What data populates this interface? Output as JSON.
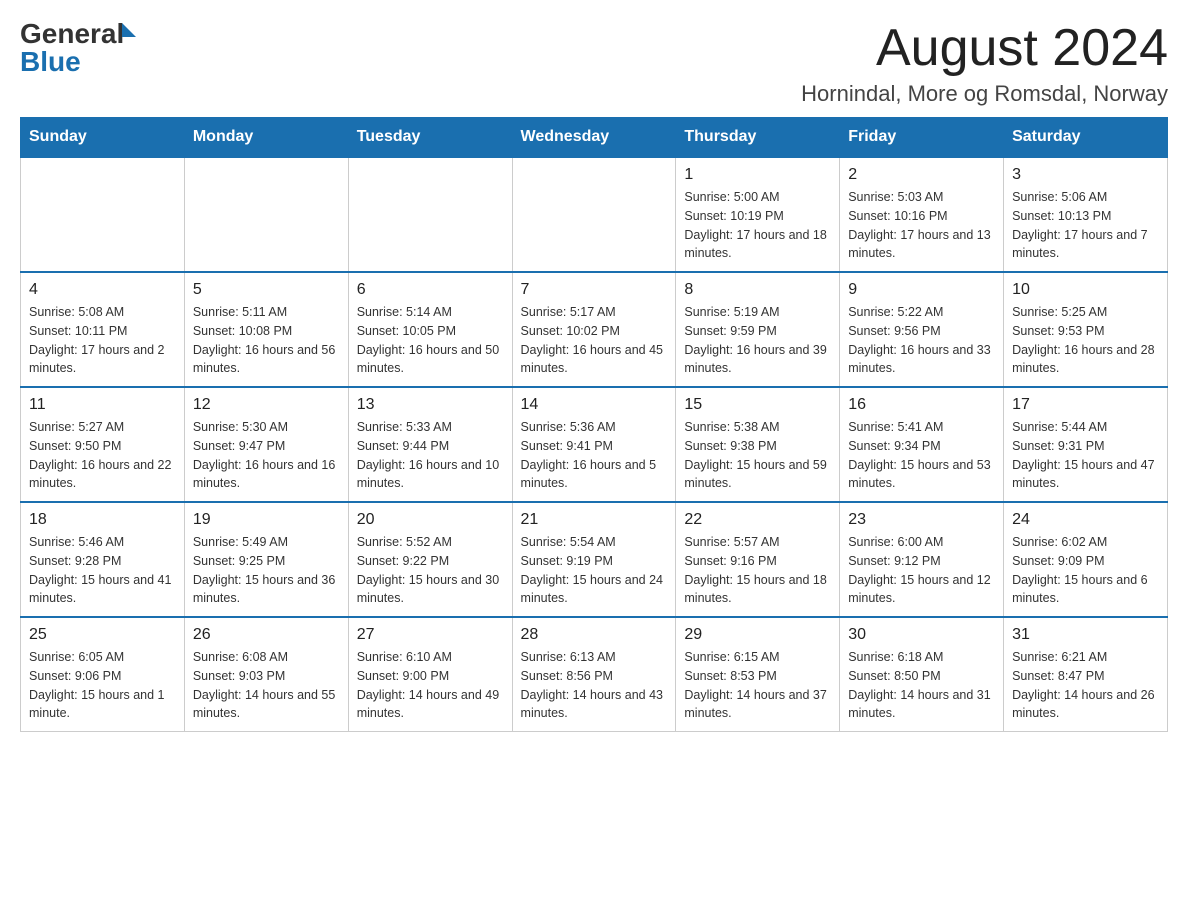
{
  "logo": {
    "general": "General",
    "blue": "Blue"
  },
  "title": {
    "month_year": "August 2024",
    "location": "Hornindal, More og Romsdal, Norway"
  },
  "days_of_week": [
    "Sunday",
    "Monday",
    "Tuesday",
    "Wednesday",
    "Thursday",
    "Friday",
    "Saturday"
  ],
  "weeks": [
    [
      {
        "day": "",
        "info": ""
      },
      {
        "day": "",
        "info": ""
      },
      {
        "day": "",
        "info": ""
      },
      {
        "day": "",
        "info": ""
      },
      {
        "day": "1",
        "info": "Sunrise: 5:00 AM\nSunset: 10:19 PM\nDaylight: 17 hours and 18 minutes."
      },
      {
        "day": "2",
        "info": "Sunrise: 5:03 AM\nSunset: 10:16 PM\nDaylight: 17 hours and 13 minutes."
      },
      {
        "day": "3",
        "info": "Sunrise: 5:06 AM\nSunset: 10:13 PM\nDaylight: 17 hours and 7 minutes."
      }
    ],
    [
      {
        "day": "4",
        "info": "Sunrise: 5:08 AM\nSunset: 10:11 PM\nDaylight: 17 hours and 2 minutes."
      },
      {
        "day": "5",
        "info": "Sunrise: 5:11 AM\nSunset: 10:08 PM\nDaylight: 16 hours and 56 minutes."
      },
      {
        "day": "6",
        "info": "Sunrise: 5:14 AM\nSunset: 10:05 PM\nDaylight: 16 hours and 50 minutes."
      },
      {
        "day": "7",
        "info": "Sunrise: 5:17 AM\nSunset: 10:02 PM\nDaylight: 16 hours and 45 minutes."
      },
      {
        "day": "8",
        "info": "Sunrise: 5:19 AM\nSunset: 9:59 PM\nDaylight: 16 hours and 39 minutes."
      },
      {
        "day": "9",
        "info": "Sunrise: 5:22 AM\nSunset: 9:56 PM\nDaylight: 16 hours and 33 minutes."
      },
      {
        "day": "10",
        "info": "Sunrise: 5:25 AM\nSunset: 9:53 PM\nDaylight: 16 hours and 28 minutes."
      }
    ],
    [
      {
        "day": "11",
        "info": "Sunrise: 5:27 AM\nSunset: 9:50 PM\nDaylight: 16 hours and 22 minutes."
      },
      {
        "day": "12",
        "info": "Sunrise: 5:30 AM\nSunset: 9:47 PM\nDaylight: 16 hours and 16 minutes."
      },
      {
        "day": "13",
        "info": "Sunrise: 5:33 AM\nSunset: 9:44 PM\nDaylight: 16 hours and 10 minutes."
      },
      {
        "day": "14",
        "info": "Sunrise: 5:36 AM\nSunset: 9:41 PM\nDaylight: 16 hours and 5 minutes."
      },
      {
        "day": "15",
        "info": "Sunrise: 5:38 AM\nSunset: 9:38 PM\nDaylight: 15 hours and 59 minutes."
      },
      {
        "day": "16",
        "info": "Sunrise: 5:41 AM\nSunset: 9:34 PM\nDaylight: 15 hours and 53 minutes."
      },
      {
        "day": "17",
        "info": "Sunrise: 5:44 AM\nSunset: 9:31 PM\nDaylight: 15 hours and 47 minutes."
      }
    ],
    [
      {
        "day": "18",
        "info": "Sunrise: 5:46 AM\nSunset: 9:28 PM\nDaylight: 15 hours and 41 minutes."
      },
      {
        "day": "19",
        "info": "Sunrise: 5:49 AM\nSunset: 9:25 PM\nDaylight: 15 hours and 36 minutes."
      },
      {
        "day": "20",
        "info": "Sunrise: 5:52 AM\nSunset: 9:22 PM\nDaylight: 15 hours and 30 minutes."
      },
      {
        "day": "21",
        "info": "Sunrise: 5:54 AM\nSunset: 9:19 PM\nDaylight: 15 hours and 24 minutes."
      },
      {
        "day": "22",
        "info": "Sunrise: 5:57 AM\nSunset: 9:16 PM\nDaylight: 15 hours and 18 minutes."
      },
      {
        "day": "23",
        "info": "Sunrise: 6:00 AM\nSunset: 9:12 PM\nDaylight: 15 hours and 12 minutes."
      },
      {
        "day": "24",
        "info": "Sunrise: 6:02 AM\nSunset: 9:09 PM\nDaylight: 15 hours and 6 minutes."
      }
    ],
    [
      {
        "day": "25",
        "info": "Sunrise: 6:05 AM\nSunset: 9:06 PM\nDaylight: 15 hours and 1 minute."
      },
      {
        "day": "26",
        "info": "Sunrise: 6:08 AM\nSunset: 9:03 PM\nDaylight: 14 hours and 55 minutes."
      },
      {
        "day": "27",
        "info": "Sunrise: 6:10 AM\nSunset: 9:00 PM\nDaylight: 14 hours and 49 minutes."
      },
      {
        "day": "28",
        "info": "Sunrise: 6:13 AM\nSunset: 8:56 PM\nDaylight: 14 hours and 43 minutes."
      },
      {
        "day": "29",
        "info": "Sunrise: 6:15 AM\nSunset: 8:53 PM\nDaylight: 14 hours and 37 minutes."
      },
      {
        "day": "30",
        "info": "Sunrise: 6:18 AM\nSunset: 8:50 PM\nDaylight: 14 hours and 31 minutes."
      },
      {
        "day": "31",
        "info": "Sunrise: 6:21 AM\nSunset: 8:47 PM\nDaylight: 14 hours and 26 minutes."
      }
    ]
  ]
}
